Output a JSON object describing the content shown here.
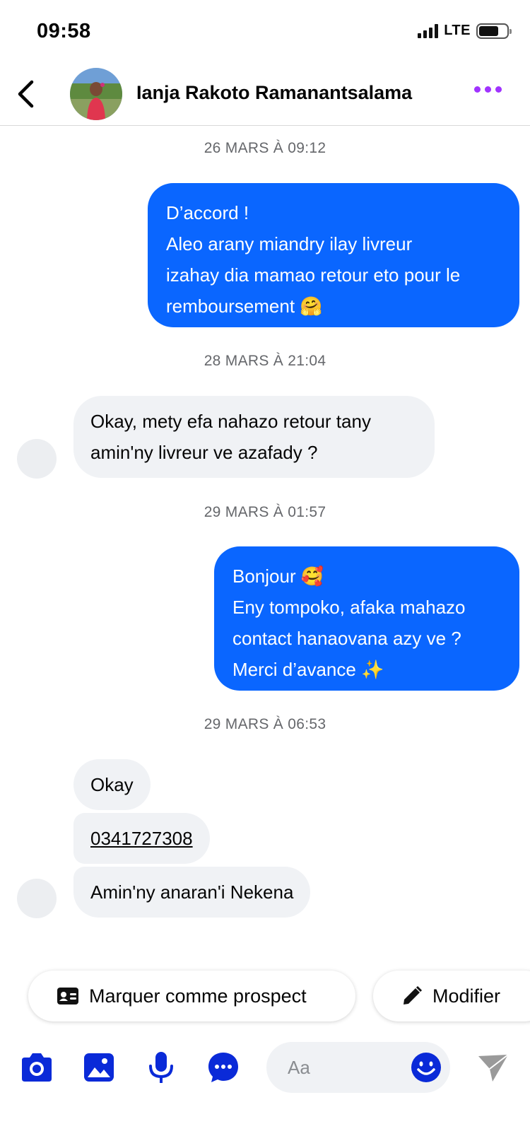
{
  "status_bar": {
    "time": "09:58",
    "network": "LTE"
  },
  "header": {
    "contact_name": "Ianja Rakoto Ramanantsalama"
  },
  "conversation": {
    "timestamps": [
      "26 MARS À 09:12",
      "28 MARS À 21:04",
      "29 MARS À 01:57",
      "29 MARS À 06:53"
    ],
    "message_1": [
      "D’accord !",
      "Aleo arany miandry ilay livreur",
      "izahay dia mamao retour eto pour le",
      "remboursement 🤗"
    ],
    "message_2": [
      "Okay, mety efa nahazo retour tany",
      "amin'ny livreur ve azafady ?"
    ],
    "message_3": [
      "Bonjour 🥰",
      "Eny tompoko, afaka mahazo",
      "contact hanaovana azy ve ?",
      "Merci d’avance ✨"
    ],
    "message_4": "Okay",
    "message_5": "0341727308",
    "message_6": "Amin'ny anaran'i Nekena"
  },
  "quick_actions": {
    "prospect_label": "Marquer comme prospect",
    "modify_label": "Modifier"
  },
  "composer": {
    "placeholder": "Aa"
  },
  "colors": {
    "accent": "#0a66ff",
    "incoming_bubble": "#f0f2f5",
    "icon_blue": "#0a2ad8",
    "more_purple": "#a033ff"
  }
}
